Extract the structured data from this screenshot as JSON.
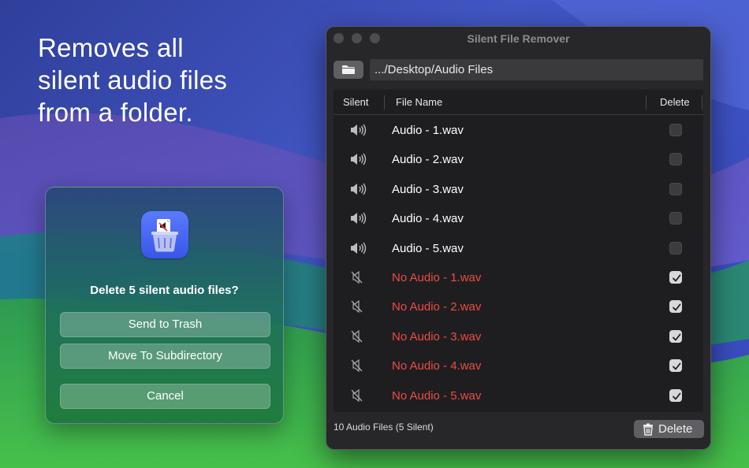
{
  "headline": {
    "line1": "Removes all",
    "line2": "silent audio files",
    "line3": "from a folder."
  },
  "dialog": {
    "app_icon": "speaker-trash-app-icon",
    "title": "Delete 5 silent audio files?",
    "buttons": {
      "trash": "Send to Trash",
      "subdir": "Move To Subdirectory",
      "cancel": "Cancel"
    }
  },
  "window": {
    "title": "Silent File Remover",
    "path": ".../Desktop/Audio Files",
    "columns": {
      "silent": "Silent",
      "name": "File Name",
      "delete": "Delete"
    },
    "rows": [
      {
        "name": "Audio - 1.wav",
        "silent": false,
        "checked": false
      },
      {
        "name": "Audio - 2.wav",
        "silent": false,
        "checked": false
      },
      {
        "name": "Audio - 3.wav",
        "silent": false,
        "checked": false
      },
      {
        "name": "Audio - 4.wav",
        "silent": false,
        "checked": false
      },
      {
        "name": "Audio - 5.wav",
        "silent": false,
        "checked": false
      },
      {
        "name": "No Audio - 1.wav",
        "silent": true,
        "checked": true
      },
      {
        "name": "No Audio - 2.wav",
        "silent": true,
        "checked": true
      },
      {
        "name": "No Audio - 3.wav",
        "silent": true,
        "checked": true
      },
      {
        "name": "No Audio - 4.wav",
        "silent": true,
        "checked": true
      },
      {
        "name": "No Audio - 5.wav",
        "silent": true,
        "checked": true
      }
    ],
    "status": "10 Audio Files (5 Silent)",
    "delete_label": "Delete"
  },
  "colors": {
    "silent_red": "#ee4b43",
    "window_bg": "#27272a",
    "table_bg": "#1e1e20",
    "accent_blue": "#4a66f0"
  },
  "icons": {
    "speaker": "speaker-wave-icon",
    "muted": "speaker-slash-icon",
    "folder": "folder-icon",
    "trash": "trash-icon",
    "check": "checkmark-icon"
  }
}
